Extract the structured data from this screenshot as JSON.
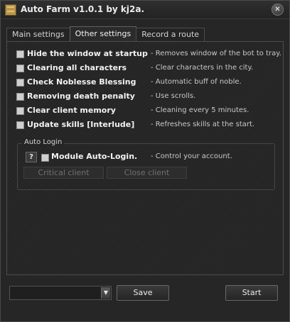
{
  "window": {
    "title": "Auto Farm v1.0.1 by kj2a.",
    "close_glyph": "✕",
    "icon": "app-logo-icon"
  },
  "tabs": [
    {
      "label": "Main settings",
      "active": false
    },
    {
      "label": "Other settings",
      "active": true
    },
    {
      "label": "Record a route",
      "active": false
    }
  ],
  "options": [
    {
      "label": "Hide the window at startup",
      "description": "- Removes window of the bot to tray.",
      "checked": false
    },
    {
      "label": "Clearing all characters",
      "description": "- Clear characters in the city.",
      "checked": false
    },
    {
      "label": "Check Noblesse Blessing",
      "description": "- Automatic buff of noble.",
      "checked": false
    },
    {
      "label": "Removing death penalty",
      "description": "- Use scrolls.",
      "checked": false
    },
    {
      "label": "Clear client memory",
      "description": "- Cleaning every 5 minutes.",
      "checked": false
    },
    {
      "label": "Update skills [Interlude]",
      "description": "- Refreshes skills at the start.",
      "checked": false
    }
  ],
  "auto_login": {
    "group_label": "Auto Login",
    "help_label": "?",
    "module_label": "Module Auto-Login.",
    "module_description": "- Control your account.",
    "module_checked": false,
    "critical_client_label": "Critical client",
    "close_client_label": "Close client"
  },
  "footer": {
    "profile_value": "",
    "dropdown_glyph": "▼",
    "save_label": "Save",
    "start_label": "Start"
  },
  "colors": {
    "window_bg": "#262626",
    "text": "#d8d8d8",
    "checkbox": "#cfcfcf"
  }
}
